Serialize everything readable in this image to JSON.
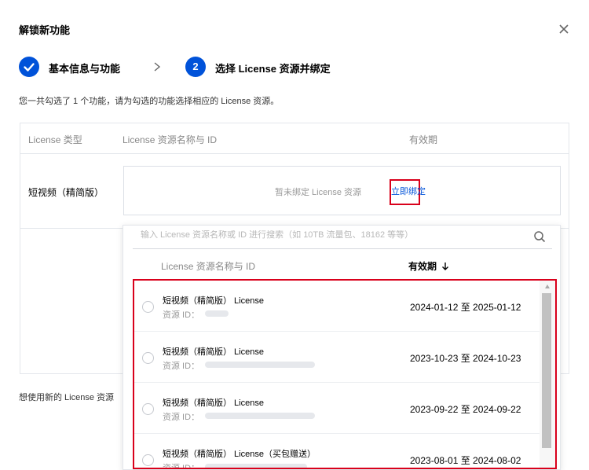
{
  "dialog": {
    "title": "解锁新功能"
  },
  "steps": [
    {
      "index": "✓",
      "label": "基本信息与功能"
    },
    {
      "index": "2",
      "label": "选择 License 资源并绑定"
    }
  ],
  "description": "您一共勾选了 1 个功能，请为勾选的功能选择相应的 License 资源。",
  "table": {
    "headers": [
      "License 类型",
      "License 资源名称与 ID",
      "有效期"
    ],
    "row": {
      "type": "短视频（精简版）",
      "unbound_text": "暂未绑定 License 资源",
      "bind_label": "立即绑定"
    }
  },
  "footer_text": "想使用新的 License 资源",
  "dropdown": {
    "search_placeholder": "输入 License 资源名称或 ID 进行搜索（如 10TB 流量包、18162 等等）",
    "headers": {
      "name": "License 资源名称与 ID",
      "valid": "有效期"
    },
    "id_label": "资源 ID：",
    "items": [
      {
        "name": "短视频（精简版） License",
        "date": "2024-01-12 至 2025-01-12"
      },
      {
        "name": "短视频（精简版） License",
        "date": "2023-10-23 至 2024-10-23"
      },
      {
        "name": "短视频（精简版） License",
        "date": "2023-09-22 至 2024-09-22"
      },
      {
        "name": "短视频（精简版） License（买包赠送）",
        "date": "2023-08-01 至 2024-08-02"
      }
    ]
  },
  "colors": {
    "primary": "#0052d9",
    "highlight": "#d9001b",
    "border": "#e3e6eb"
  },
  "icons": {
    "close": "close-icon",
    "step_done": "check-icon",
    "step_arrow": "chevron-right-icon",
    "search": "search-icon",
    "sort": "arrow-down-icon"
  }
}
